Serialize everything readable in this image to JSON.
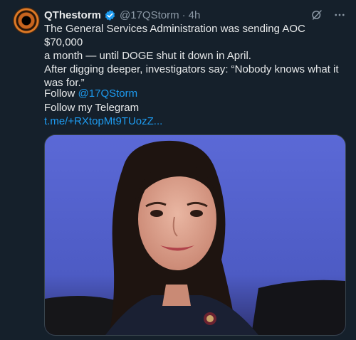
{
  "tweet": {
    "author_name": "QThestorm",
    "handle": "@17QStorm",
    "separator": "·",
    "time": "4h",
    "body": "The General Services Administration was sending AOC $70,000\na month — until DOGE shut it down in April.\nAfter digging deeper, investigators say: “Nobody knows what it\nwas for.”",
    "follow_label": "Follow",
    "follow_handle": "@17QStorm",
    "telegram_label": "Follow my Telegram",
    "telegram_link": "t.me/+RXtopMt9TUozZ..."
  },
  "icons": {
    "verified": "verified-badge-icon",
    "grok": "grok-icon",
    "more": "more-icon"
  },
  "colors": {
    "background": "#15202b",
    "accent": "#1d9bf0",
    "secondary_text": "#8b98a5"
  }
}
